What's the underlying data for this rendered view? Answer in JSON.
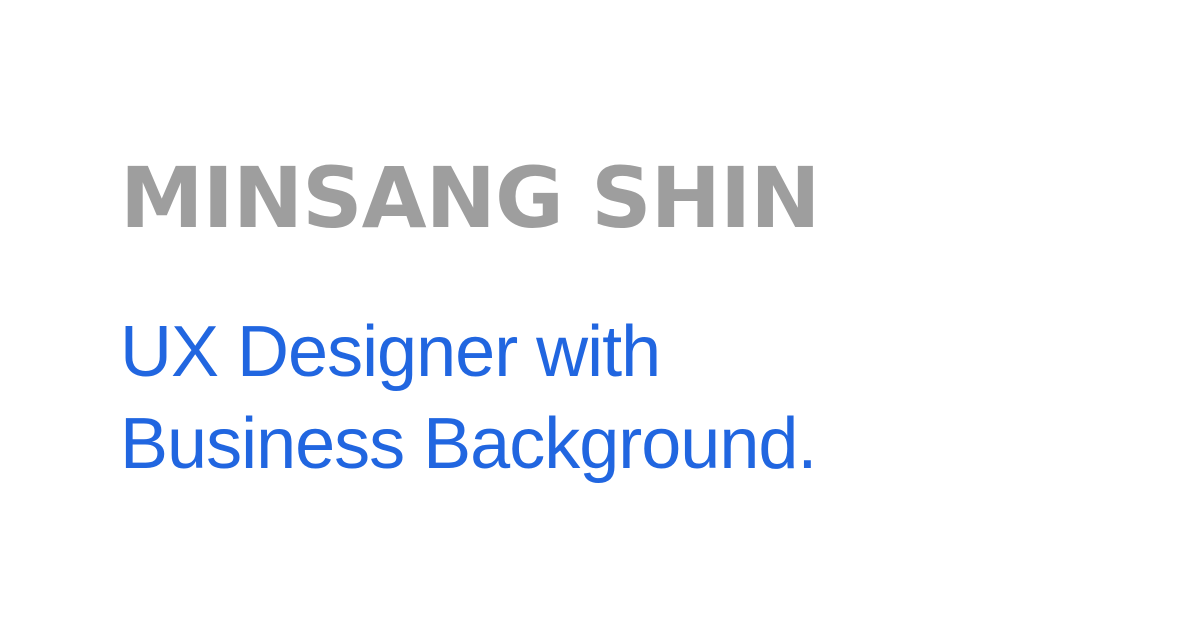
{
  "card": {
    "name": "MINSANG SHIN",
    "tagline_line1": "UX Designer with",
    "tagline_line2": "Business Background."
  },
  "colors": {
    "background": "#ffffff",
    "name": "#9e9e9e",
    "tagline": "#2166e0"
  }
}
